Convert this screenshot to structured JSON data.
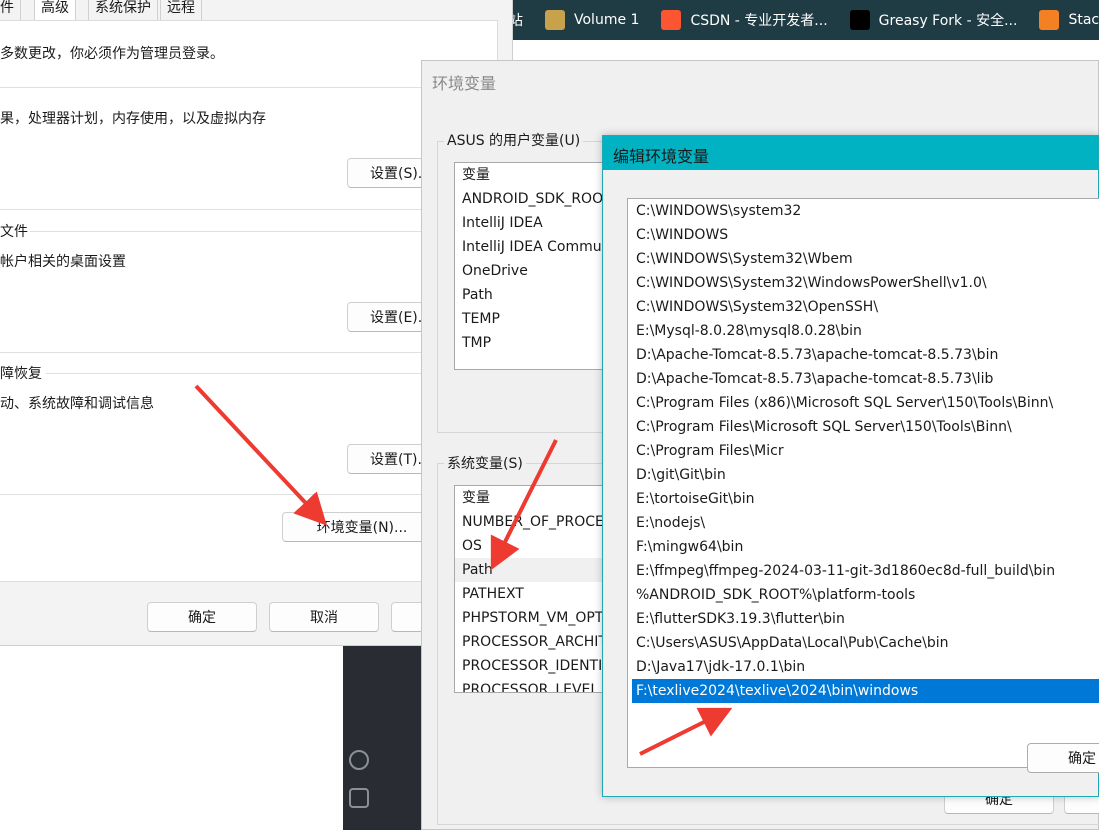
{
  "bookmarks": [
    {
      "icon": "site-icon",
      "label": "站",
      "color": "#1f3b44"
    },
    {
      "icon": "volume-icon",
      "label": "Volume 1",
      "color": "#c8a24a"
    },
    {
      "icon": "csdn-icon",
      "label": "CSDN - 专业开发者...",
      "color": "#fc5531"
    },
    {
      "icon": "greasyfork-icon",
      "label": "Greasy Fork - 安全...",
      "color": "#000000"
    },
    {
      "icon": "stackoverflow-icon",
      "label": "Stack",
      "color": "#f48024"
    }
  ],
  "system_properties": {
    "tabs": [
      "件",
      "高级",
      "系统保护",
      "远程"
    ],
    "active_tab": "高级",
    "admin_note": "多数更改，你必须作为管理员登录。",
    "performance_desc": "果，处理器计划，内存使用，以及虚拟内存",
    "performance_settings": "设置(S)...",
    "profile_heading": "文件",
    "profile_desc": "帐户相关的桌面设置",
    "profile_settings": "设置(E)...",
    "startup_heading": "障恢复",
    "startup_desc": "动、系统故障和调试信息",
    "startup_settings": "设置(T)...",
    "env_button": "环境变量(N)...",
    "ok": "确定",
    "cancel": "取消"
  },
  "environment_variables": {
    "title": "环境变量",
    "user_group": "ASUS 的用户变量(U)",
    "user_header": "变量",
    "user_vars": [
      "ANDROID_SDK_ROOT",
      "IntelliJ IDEA",
      "IntelliJ IDEA Community",
      "OneDrive",
      "Path",
      "TEMP",
      "TMP"
    ],
    "system_group": "系统变量(S)",
    "system_header": "变量",
    "system_vars": [
      "NUMBER_OF_PROCESSORS",
      "OS",
      "Path",
      "PATHEXT",
      "PHPSTORM_VM_OPTIONS",
      "PROCESSOR_ARCHITECTURE",
      "PROCESSOR_IDENTIFIER",
      "PROCESSOR_LEVEL"
    ],
    "selected_system_var": "Path",
    "ok": "确定"
  },
  "edit_env": {
    "title": "编辑环境变量",
    "paths": [
      "C:\\WINDOWS\\system32",
      "C:\\WINDOWS",
      "C:\\WINDOWS\\System32\\Wbem",
      "C:\\WINDOWS\\System32\\WindowsPowerShell\\v1.0\\",
      "C:\\WINDOWS\\System32\\OpenSSH\\",
      "E:\\Mysql-8.0.28\\mysql8.0.28\\bin",
      "D:\\Apache-Tomcat-8.5.73\\apache-tomcat-8.5.73\\bin",
      "D:\\Apache-Tomcat-8.5.73\\apache-tomcat-8.5.73\\lib",
      "C:\\Program Files (x86)\\Microsoft SQL Server\\150\\Tools\\Binn\\",
      "C:\\Program Files\\Microsoft SQL Server\\150\\Tools\\Binn\\",
      "C:\\Program Files\\Micr",
      "D:\\git\\Git\\bin",
      "E:\\tortoiseGit\\bin",
      "E:\\nodejs\\",
      "F:\\mingw64\\bin",
      "E:\\ffmpeg\\ffmpeg-2024-03-11-git-3d1860ec8d-full_build\\bin",
      "%ANDROID_SDK_ROOT%\\platform-tools",
      "E:\\flutterSDK3.19.3\\flutter\\bin",
      "C:\\Users\\ASUS\\AppData\\Local\\Pub\\Cache\\bin",
      "D:\\Java17\\jdk-17.0.1\\bin",
      "F:\\texlive2024\\texlive\\2024\\bin\\windows"
    ],
    "selected_index": 20,
    "ok": "确定"
  },
  "colors": {
    "accent_teal": "#00b2c2",
    "selection_blue": "#0078d7",
    "arrow_red": "#ee3b32"
  }
}
